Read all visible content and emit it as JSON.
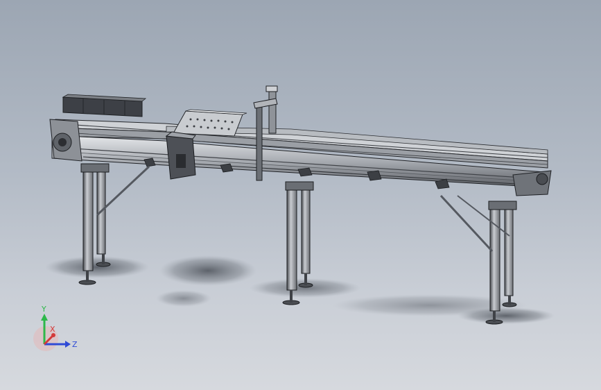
{
  "viewport": {
    "background_top": "#9ca6b3",
    "background_bottom": "#d6d9de",
    "model": "conveyor-assembly"
  },
  "triad": {
    "x_label": "X",
    "y_label": "Y",
    "z_label": "Z",
    "x_color": "#d33a3a",
    "y_color": "#2db84a",
    "z_color": "#2f4bd6"
  }
}
